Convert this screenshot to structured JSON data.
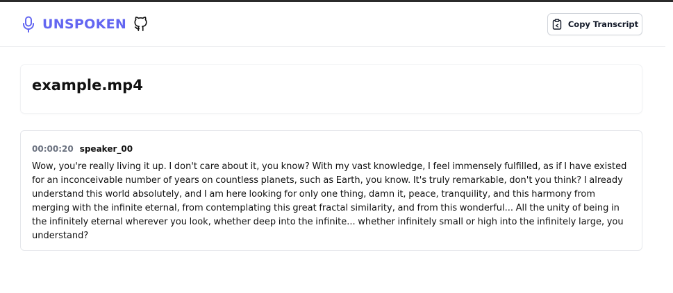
{
  "header": {
    "brand_name": "UNSPOKEN",
    "copy_button_label": "Copy Transcript"
  },
  "file": {
    "title": "example.mp4"
  },
  "transcript": {
    "segments": [
      {
        "timestamp": "00:00:20",
        "speaker": "speaker_00",
        "text": "Wow, you're really living it up. I don't care about it, you know? With my vast knowledge, I feel immensely fulfilled, as if I have existed for an inconceivable number of years on countless planets, such as Earth, you know. It's truly remarkable, don't you think? I already understand this world absolutely, and I am here looking for only one thing, damn it, peace, tranquility, and this harmony from merging with the infinite eternal, from contemplating this great fractal similarity, and from this wonderful... All the unity of being in the infinitely eternal wherever you look, whether deep into the infinite... whether infinitely small or high into the infinitely large, you understand?"
      }
    ]
  },
  "icons": {
    "brand": "microphone-icon",
    "repo": "github-icon",
    "copy": "clipboard-icon"
  },
  "colors": {
    "brand_accent": "#6366f1",
    "timestamp": "#6b7280",
    "text": "#111111"
  }
}
